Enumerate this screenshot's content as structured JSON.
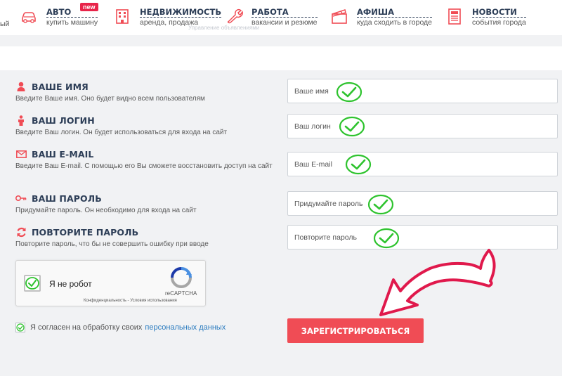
{
  "nav": {
    "edge_text": "ый",
    "ghost_text": "Управление объявлениями",
    "items": [
      {
        "title": "АВТО",
        "subtitle": "купить машину",
        "badge": "new",
        "icon": "car-icon"
      },
      {
        "title": "НЕДВИЖИМОСТЬ",
        "subtitle": "аренда, продажа",
        "icon": "building-icon"
      },
      {
        "title": "РАБОТА",
        "subtitle": "вакансии и резюме",
        "icon": "wrench-icon"
      },
      {
        "title": "АФИША",
        "subtitle": "куда сходить в городе",
        "icon": "clapperboard-icon"
      },
      {
        "title": "НОВОСТИ",
        "subtitle": "события города",
        "icon": "newspaper-icon"
      }
    ]
  },
  "form": {
    "name": {
      "title": "ВАШЕ ИМЯ",
      "desc": "Введите Ваше имя. Оно будет видно всем пользователям",
      "placeholder": "Ваше имя",
      "value": "",
      "icon": "user-icon"
    },
    "login": {
      "title": "ВАШ ЛОГИН",
      "desc": "Введите Ваш логин. Он будет использоваться для входа на сайт",
      "placeholder": "Ваш логин",
      "value": "",
      "icon": "person-icon"
    },
    "email": {
      "title": "ВАШ E-MAIL",
      "desc": "Введите Ваш E-mail. С помощью его Вы сможете восстановить доступ на сайт",
      "placeholder": "Ваш E-mail",
      "value": "",
      "icon": "envelope-icon"
    },
    "password": {
      "title": "ВАШ ПАРОЛЬ",
      "desc": "Придумайте пароль. Он необходимо для входа на сайт",
      "placeholder": "Придумайте пароль",
      "value": "",
      "icon": "key-icon"
    },
    "password_repeat": {
      "title": "ПОВТОРИТЕ ПАРОЛЬ",
      "desc": "Повторите пароль, что бы не совершить ошибку при вводе",
      "placeholder": "Повторите пароль",
      "value": "",
      "icon": "refresh-icon"
    }
  },
  "recaptcha": {
    "label": "Я не робот",
    "brand": "reCAPTCHA",
    "links": "Конфиденциальность - Условия использования",
    "checked": true
  },
  "consent": {
    "text": "Я согласен на обработку своих",
    "link": "персональных данных",
    "checked": true
  },
  "submit": {
    "label": "ЗАРЕГИСТРИРОВАТЬСЯ"
  },
  "colors": {
    "accent_red": "#f04c55",
    "nav_blue": "#2d3e57",
    "check_green": "#2ec32e",
    "arrow_red": "#e0194c",
    "link_blue": "#2a7bbf"
  }
}
